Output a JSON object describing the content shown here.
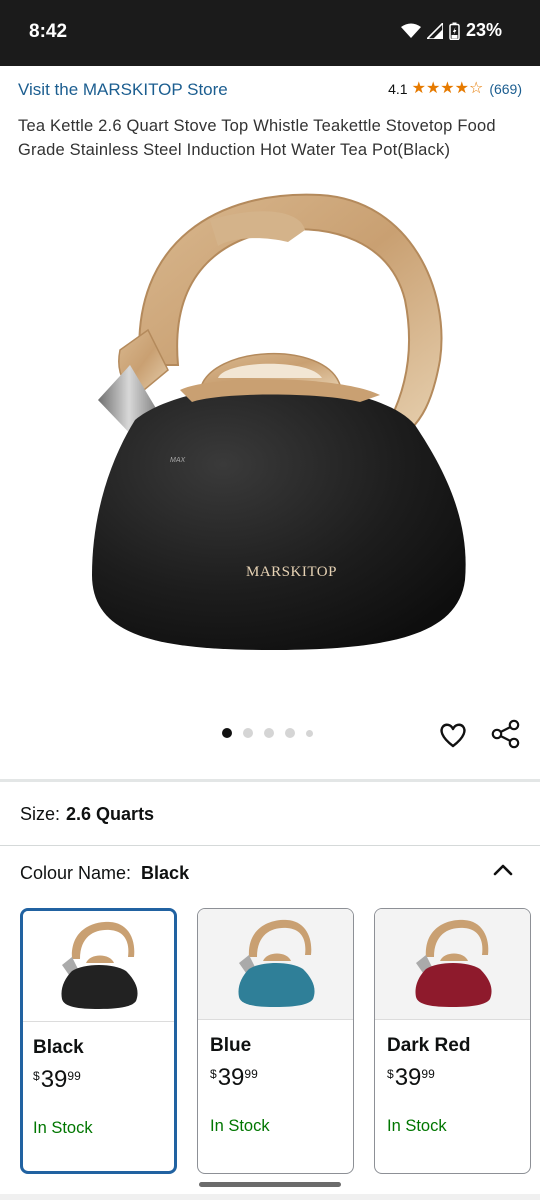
{
  "status_bar": {
    "time": "8:42",
    "battery": "23%"
  },
  "store": {
    "link_label": "Visit the MARSKITOP Store"
  },
  "rating": {
    "value": "4.1",
    "stars": 4.1,
    "count": "(669)"
  },
  "product": {
    "title": "Tea Kettle 2.6 Quart Stove Top Whistle Teakettle Stovetop Food Grade Stainless Steel Induction Hot Water Tea Pot(Black)",
    "image_brand_text": "MARSKITOP",
    "image_max_text": "MAX",
    "image_count": 5,
    "active_image_index": 0
  },
  "size": {
    "label": "Size:",
    "value": "2.6 Quarts"
  },
  "colour": {
    "label": "Colour Name:",
    "value": "Black"
  },
  "swatches": [
    {
      "name": "Black",
      "currency": "$",
      "whole": "39",
      "fraction": "99",
      "stock": "In Stock",
      "color": "#222222",
      "selected": true
    },
    {
      "name": "Blue",
      "currency": "$",
      "whole": "39",
      "fraction": "99",
      "stock": "In Stock",
      "color": "#2f7f98",
      "selected": false
    },
    {
      "name": "Dark Red",
      "currency": "$",
      "whole": "39",
      "fraction": "99",
      "stock": "In Stock",
      "color": "#8e1a2c",
      "selected": false
    }
  ],
  "colors": {
    "link": "#1c5e90",
    "star": "#e67a00",
    "in_stock": "#007600",
    "selected_border": "#2162a1"
  },
  "icons": {
    "wishlist": "heart-icon",
    "share": "share-icon",
    "collapse": "chevron-up-icon"
  }
}
